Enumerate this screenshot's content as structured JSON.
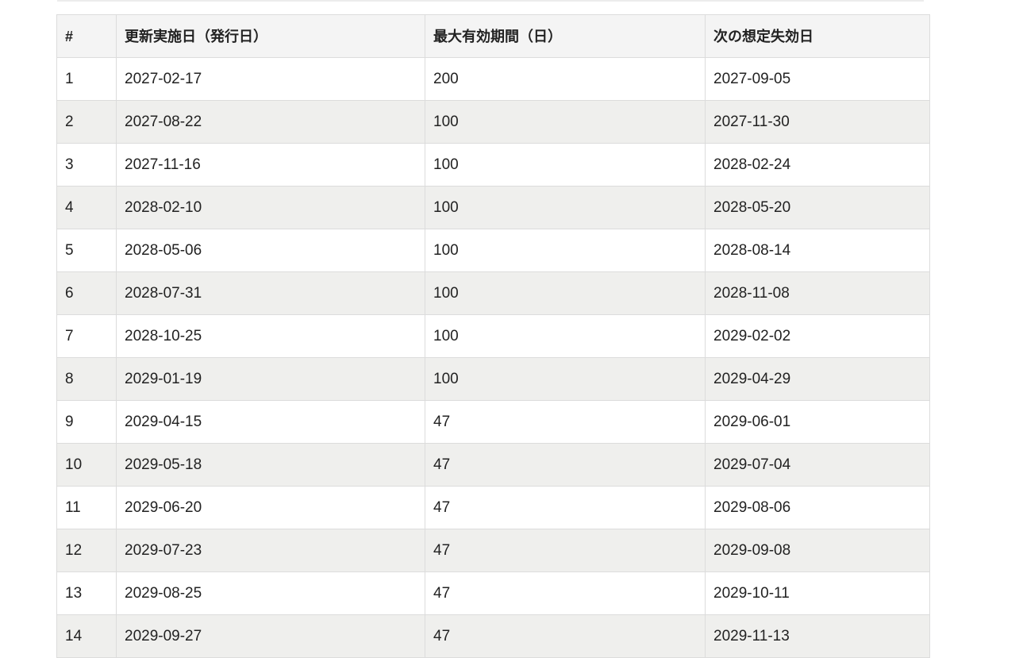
{
  "table": {
    "headers": [
      "#",
      "更新実施日（発行日）",
      "最大有効期間（日）",
      "次の想定失効日"
    ],
    "rows": [
      [
        "1",
        "2027-02-17",
        "200",
        "2027-09-05"
      ],
      [
        "2",
        "2027-08-22",
        "100",
        "2027-11-30"
      ],
      [
        "3",
        "2027-11-16",
        "100",
        "2028-02-24"
      ],
      [
        "4",
        "2028-02-10",
        "100",
        "2028-05-20"
      ],
      [
        "5",
        "2028-05-06",
        "100",
        "2028-08-14"
      ],
      [
        "6",
        "2028-07-31",
        "100",
        "2028-11-08"
      ],
      [
        "7",
        "2028-10-25",
        "100",
        "2029-02-02"
      ],
      [
        "8",
        "2029-01-19",
        "100",
        "2029-04-29"
      ],
      [
        "9",
        "2029-04-15",
        "47",
        "2029-06-01"
      ],
      [
        "10",
        "2029-05-18",
        "47",
        "2029-07-04"
      ],
      [
        "11",
        "2029-06-20",
        "47",
        "2029-08-06"
      ],
      [
        "12",
        "2029-07-23",
        "47",
        "2029-09-08"
      ],
      [
        "13",
        "2029-08-25",
        "47",
        "2029-10-11"
      ],
      [
        "14",
        "2029-09-27",
        "47",
        "2029-11-13"
      ]
    ]
  }
}
